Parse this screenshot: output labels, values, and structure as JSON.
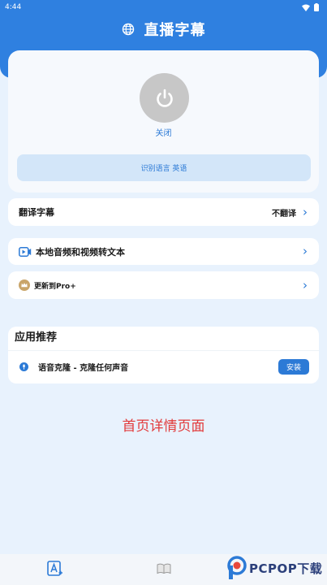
{
  "status_bar": {
    "time": "4:44"
  },
  "header": {
    "title": "直播字幕",
    "icon": "globe-icon"
  },
  "power": {
    "label": "关闭",
    "icon": "power-icon",
    "state": "off"
  },
  "language": {
    "label": "识别语言 英语"
  },
  "translate_row": {
    "label": "翻译字幕",
    "value": "不翻译"
  },
  "convert_row": {
    "label": "本地音频和视频转文本",
    "icon": "video-icon"
  },
  "pro_row": {
    "label": "更新到Pro+",
    "icon": "crown-icon"
  },
  "recommend": {
    "title": "应用推荐",
    "items": [
      {
        "label": "语音克隆 - 克隆任何声音",
        "button": "安装",
        "icon": "mic-icon"
      }
    ]
  },
  "caption": "首页详情页面",
  "bottom_nav": {
    "items": [
      {
        "icon": "text-a-plus-icon"
      },
      {
        "icon": "book-icon"
      }
    ]
  },
  "watermark": {
    "text": "PCPOP下载"
  },
  "colors": {
    "primary": "#2f80e0",
    "accent": "#2c7ad6",
    "background": "#e8f2fd",
    "caption": "#e23b3b",
    "power_off": "#c7c7c7"
  }
}
